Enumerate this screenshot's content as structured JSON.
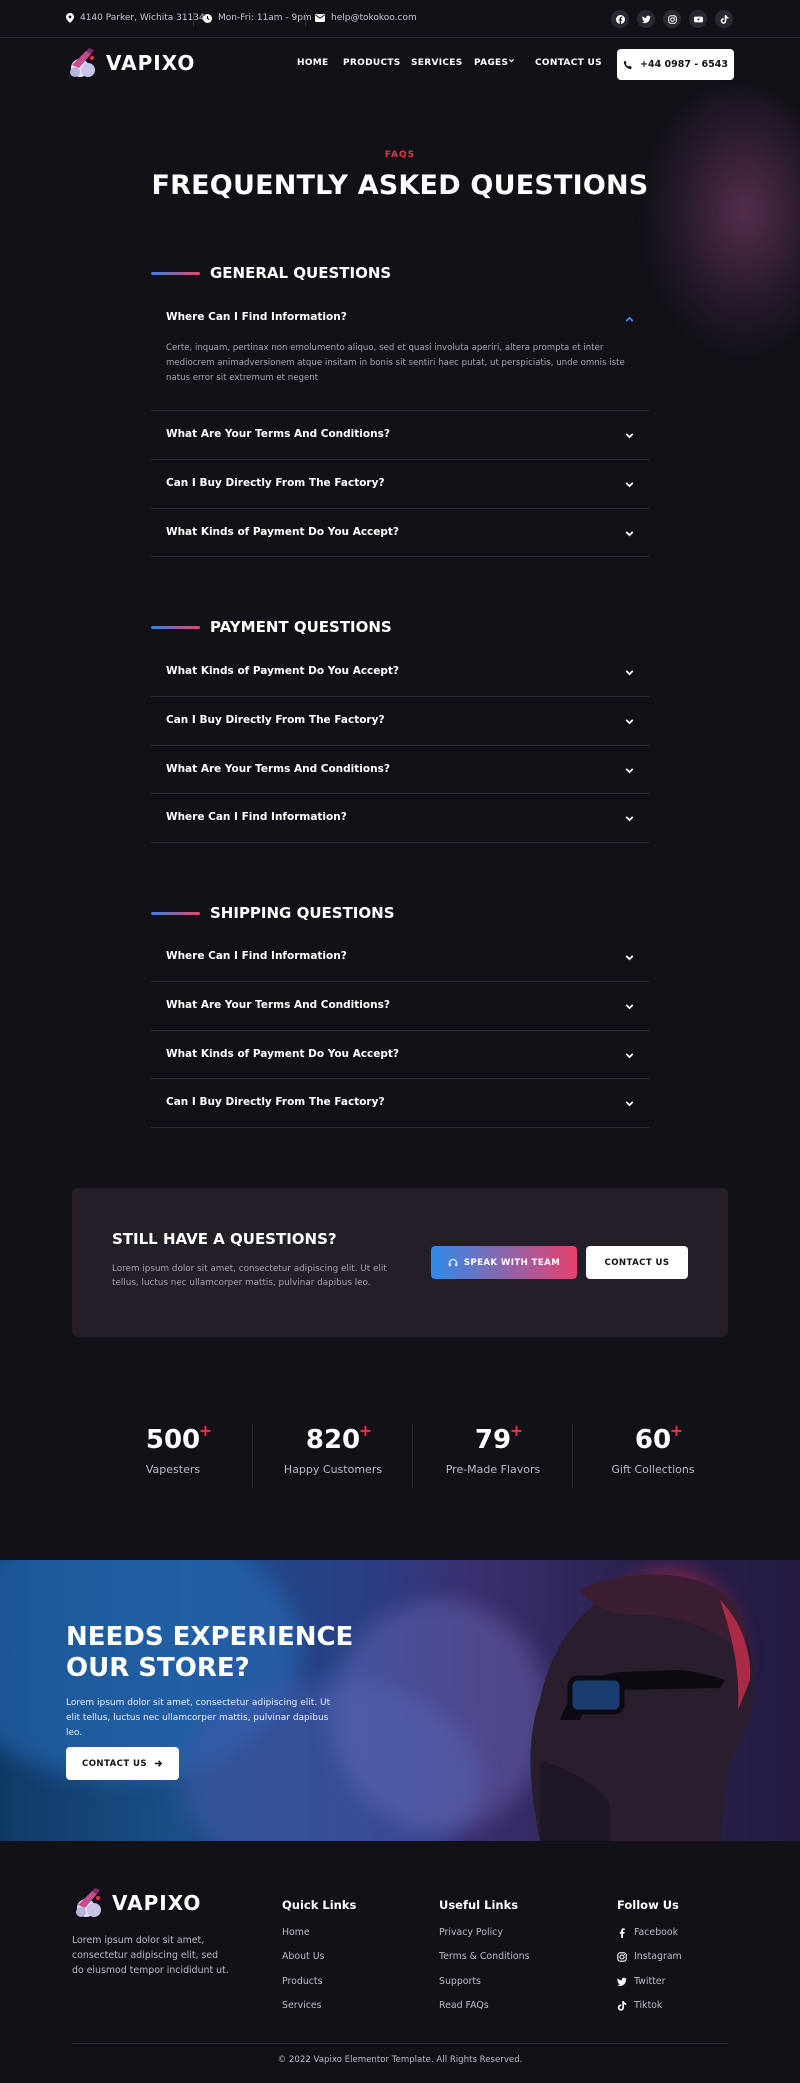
{
  "topbar": {
    "address": "4140 Parker, Wichita 31134",
    "hours": "Mon-Fri: 11am - 9pm",
    "email": "help@tokokoo.com",
    "socials": [
      "facebook-icon",
      "twitter-icon",
      "instagram-icon",
      "youtube-icon",
      "tiktok-icon"
    ]
  },
  "header": {
    "logo_text": "VAPIXO",
    "nav": [
      "HOME",
      "PRODUCTS",
      "SERVICES",
      "PAGES",
      "CONTACT US"
    ],
    "phone": "+44 0987 - 6543"
  },
  "faq": {
    "eyebrow": "FAQS",
    "title": "FREQUENTLY ASKED QUESTIONS",
    "sections": [
      {
        "title": "GENERAL QUESTIONS",
        "items": [
          {
            "q": "Where Can I Find Information?",
            "open": true,
            "a": "Certe, inquam, pertinax non emolumento aliquo, sed et quasi involuta aperiri, altera prompta et inter mediocrem animadversionem atque insitam in bonis sit sentiri haec putat, ut perspiciatis, unde omnis iste natus error sit extremum et negent"
          },
          {
            "q": "What Are Your Terms And Conditions?",
            "open": false
          },
          {
            "q": "Can I Buy Directly From The Factory?",
            "open": false
          },
          {
            "q": "What Kinds of Payment Do You Accept?",
            "open": false
          }
        ]
      },
      {
        "title": "PAYMENT QUESTIONS",
        "items": [
          {
            "q": "What Kinds of Payment Do You Accept?",
            "open": false
          },
          {
            "q": "Can I Buy Directly From The Factory?",
            "open": false
          },
          {
            "q": "What Are Your Terms And Conditions?",
            "open": false
          },
          {
            "q": "Where Can I Find Information?",
            "open": false
          }
        ]
      },
      {
        "title": "SHIPPING QUESTIONS",
        "items": [
          {
            "q": "Where Can I Find Information?",
            "open": false
          },
          {
            "q": "What Are Your Terms And Conditions?",
            "open": false
          },
          {
            "q": "What Kinds of Payment Do You Accept?",
            "open": false
          },
          {
            "q": "Can I Buy Directly From The Factory?",
            "open": false
          }
        ]
      }
    ]
  },
  "cta": {
    "title": "STILL HAVE A QUESTIONS?",
    "text": "Lorem ipsum dolor sit amet, consectetur adipiscing elit. Ut elit tellus, luctus nec ullamcorper mattis, pulvinar dapibus leo.",
    "primary": "SPEAK WITH TEAM",
    "secondary": "CONTACT US"
  },
  "stats": [
    {
      "value": "500",
      "suffix": "+",
      "label": "Vapesters"
    },
    {
      "value": "820",
      "suffix": "+",
      "label": "Happy Customers"
    },
    {
      "value": "79",
      "suffix": "+",
      "label": "Pre-Made Flavors"
    },
    {
      "value": "60",
      "suffix": "+",
      "label": "Gift Collections"
    }
  ],
  "banner": {
    "title_line1": "NEEDS EXPERIENCE",
    "title_line2": "OUR STORE?",
    "text": "Lorem ipsum dolor sit amet, consectetur adipiscing elit. Ut elit tellus, luctus nec ullamcorper mattis, pulvinar dapibus leo.",
    "button": "CONTACT US"
  },
  "footer": {
    "logo_text": "VAPIXO",
    "about": "Lorem ipsum dolor sit amet, consectetur adipiscing elit, sed do eiusmod tempor incididunt ut.",
    "quick_title": "Quick Links",
    "quick_links": [
      "Home",
      "About Us",
      "Products",
      "Services"
    ],
    "useful_title": "Useful Links",
    "useful_links": [
      "Privacy Policy",
      "Terms & Conditions",
      "Supports",
      "Read FAQs"
    ],
    "follow_title": "Follow Us",
    "follow_links": [
      "Facebook",
      "Instagram",
      "Twitter",
      "Tiktok"
    ],
    "copyright": "© 2022 Vapixo Elementor Template. All Rights Reserved."
  },
  "colors": {
    "background": "#131118",
    "accent_red": "#e8334a",
    "gradient_blue": "#2f8bea",
    "gradient_pink": "#e8416e",
    "card": "#231e28"
  }
}
